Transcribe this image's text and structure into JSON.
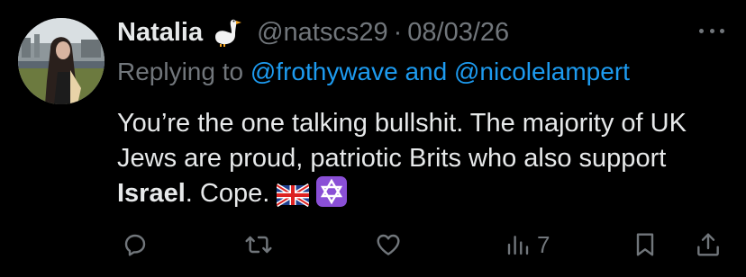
{
  "author": {
    "name": "Natalia",
    "handle": "@natscs29",
    "separator": "·",
    "date": "08/03/26"
  },
  "reply": {
    "prefix": "Replying to",
    "mention1": "@frothywave",
    "joiner": "and",
    "mention2": "@nicolelampert"
  },
  "tweet": {
    "part1": "You’re the one talking bullshit. The majority of UK Jews are proud, patriotic Brits who also support",
    "bold": "Israel",
    "part2": ". Cope."
  },
  "stats": {
    "views": "7"
  },
  "icons": [
    "goose-icon",
    "more-icon",
    "uk-flag-icon",
    "star-of-david-icon",
    "reply-icon",
    "retweet-icon",
    "like-icon",
    "views-icon",
    "bookmark-icon",
    "share-icon"
  ],
  "colors": {
    "background": "#000000",
    "text": "#e7e9ea",
    "muted": "#71767b",
    "link": "#1d9bf0",
    "star_badge": "#8a4fd6"
  }
}
